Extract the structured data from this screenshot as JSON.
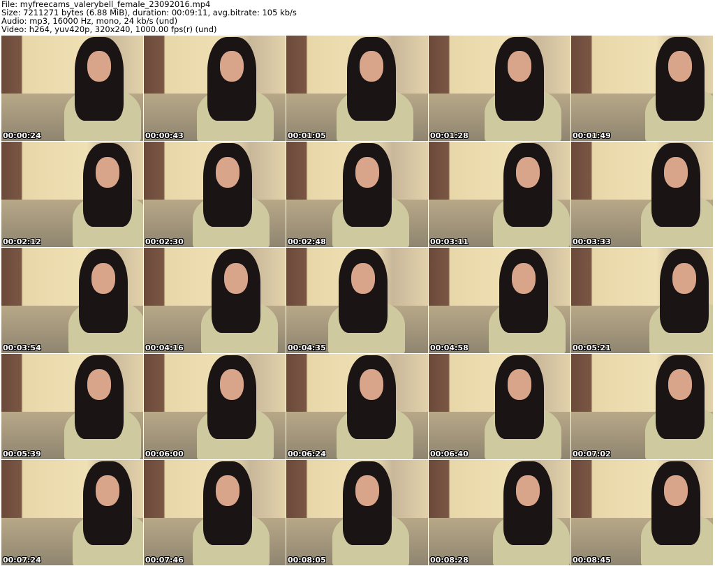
{
  "header": {
    "file": "File: myfreecams_valerybell_female_23092016.mp4",
    "size": "Size: 7211271 bytes (6.88 MiB), duration: 00:09:11, avg.bitrate: 105 kb/s",
    "audio": "Audio: mp3, 16000 Hz, mono, 24 kb/s (und)",
    "video": "Video: h264, yuv420p, 320x240, 1000.00 fps(r) (und)"
  },
  "thumbnails": [
    {
      "timestamp": "00:00:24"
    },
    {
      "timestamp": "00:00:43"
    },
    {
      "timestamp": "00:01:05"
    },
    {
      "timestamp": "00:01:28"
    },
    {
      "timestamp": "00:01:49"
    },
    {
      "timestamp": "00:02:12"
    },
    {
      "timestamp": "00:02:30"
    },
    {
      "timestamp": "00:02:48"
    },
    {
      "timestamp": "00:03:11"
    },
    {
      "timestamp": "00:03:33"
    },
    {
      "timestamp": "00:03:54"
    },
    {
      "timestamp": "00:04:16"
    },
    {
      "timestamp": "00:04:35"
    },
    {
      "timestamp": "00:04:58"
    },
    {
      "timestamp": "00:05:21"
    },
    {
      "timestamp": "00:05:39"
    },
    {
      "timestamp": "00:06:00"
    },
    {
      "timestamp": "00:06:24"
    },
    {
      "timestamp": "00:06:40"
    },
    {
      "timestamp": "00:07:02"
    },
    {
      "timestamp": "00:07:24"
    },
    {
      "timestamp": "00:07:46"
    },
    {
      "timestamp": "00:08:05"
    },
    {
      "timestamp": "00:08:28"
    },
    {
      "timestamp": "00:08:45"
    }
  ]
}
